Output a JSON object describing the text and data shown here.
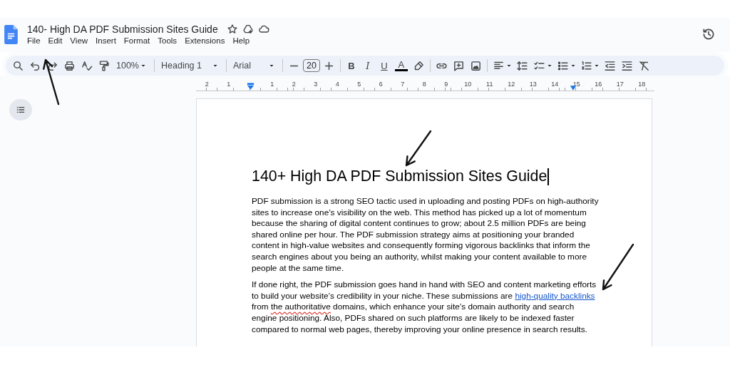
{
  "document": {
    "title": "140- High DA PDF Submission Sites Guide"
  },
  "menu": [
    "File",
    "Edit",
    "View",
    "Insert",
    "Format",
    "Tools",
    "Extensions",
    "Help"
  ],
  "toolbar": {
    "zoom": "100%",
    "style": "Heading 1",
    "font": "Arial",
    "font_size": "20",
    "format": [
      {
        "label": "B",
        "kind": "bold"
      },
      {
        "label": "I",
        "kind": "italic"
      },
      {
        "label": "U",
        "kind": "underline"
      },
      {
        "label": "A",
        "kind": "text_color"
      }
    ]
  },
  "ruler": {
    "left_labels": [
      "2",
      "1"
    ],
    "right_labels": [
      "1",
      "2",
      "3",
      "4",
      "5",
      "6",
      "7",
      "8",
      "9",
      "10",
      "11",
      "12",
      "13",
      "14",
      "15",
      "16",
      "17",
      "18"
    ]
  },
  "page": {
    "heading": "140+ High DA PDF Submission Sites Guide",
    "paragraphs": [
      {
        "segments": [
          {
            "kind": "text",
            "text": "PDF submission is a strong SEO tactic used in uploading and posting PDFs on high-authority sites to increase one’s visibility on the web. This method has picked up a lot of momentum because the sharing of digital content continues to grow; about 2.5 million PDFs are being shared online per hour. The PDF submission strategy aims at positioning your branded content in high-value websites and consequently forming vigorous backlinks that inform the search engines about you being an authority, whilst making your content available to more people at the same time."
          }
        ]
      },
      {
        "segments": [
          {
            "kind": "text",
            "text": "If done right, the PDF submission goes hand in hand with SEO and content marketing efforts to build your website’s credibility in your niche. These submissions are "
          },
          {
            "kind": "link",
            "text": "high-quality backlinks"
          },
          {
            "kind": "text",
            "text": " from "
          },
          {
            "kind": "misspelled",
            "text": "the authoritative"
          },
          {
            "kind": "text",
            "text": " domains, which enhance your site’s domain authority and search engine positioning. Also, PDFs shared on such platforms are likely to be indexed faster compared to normal web pages, thereby improving your online presence in search results."
          }
        ]
      }
    ]
  }
}
